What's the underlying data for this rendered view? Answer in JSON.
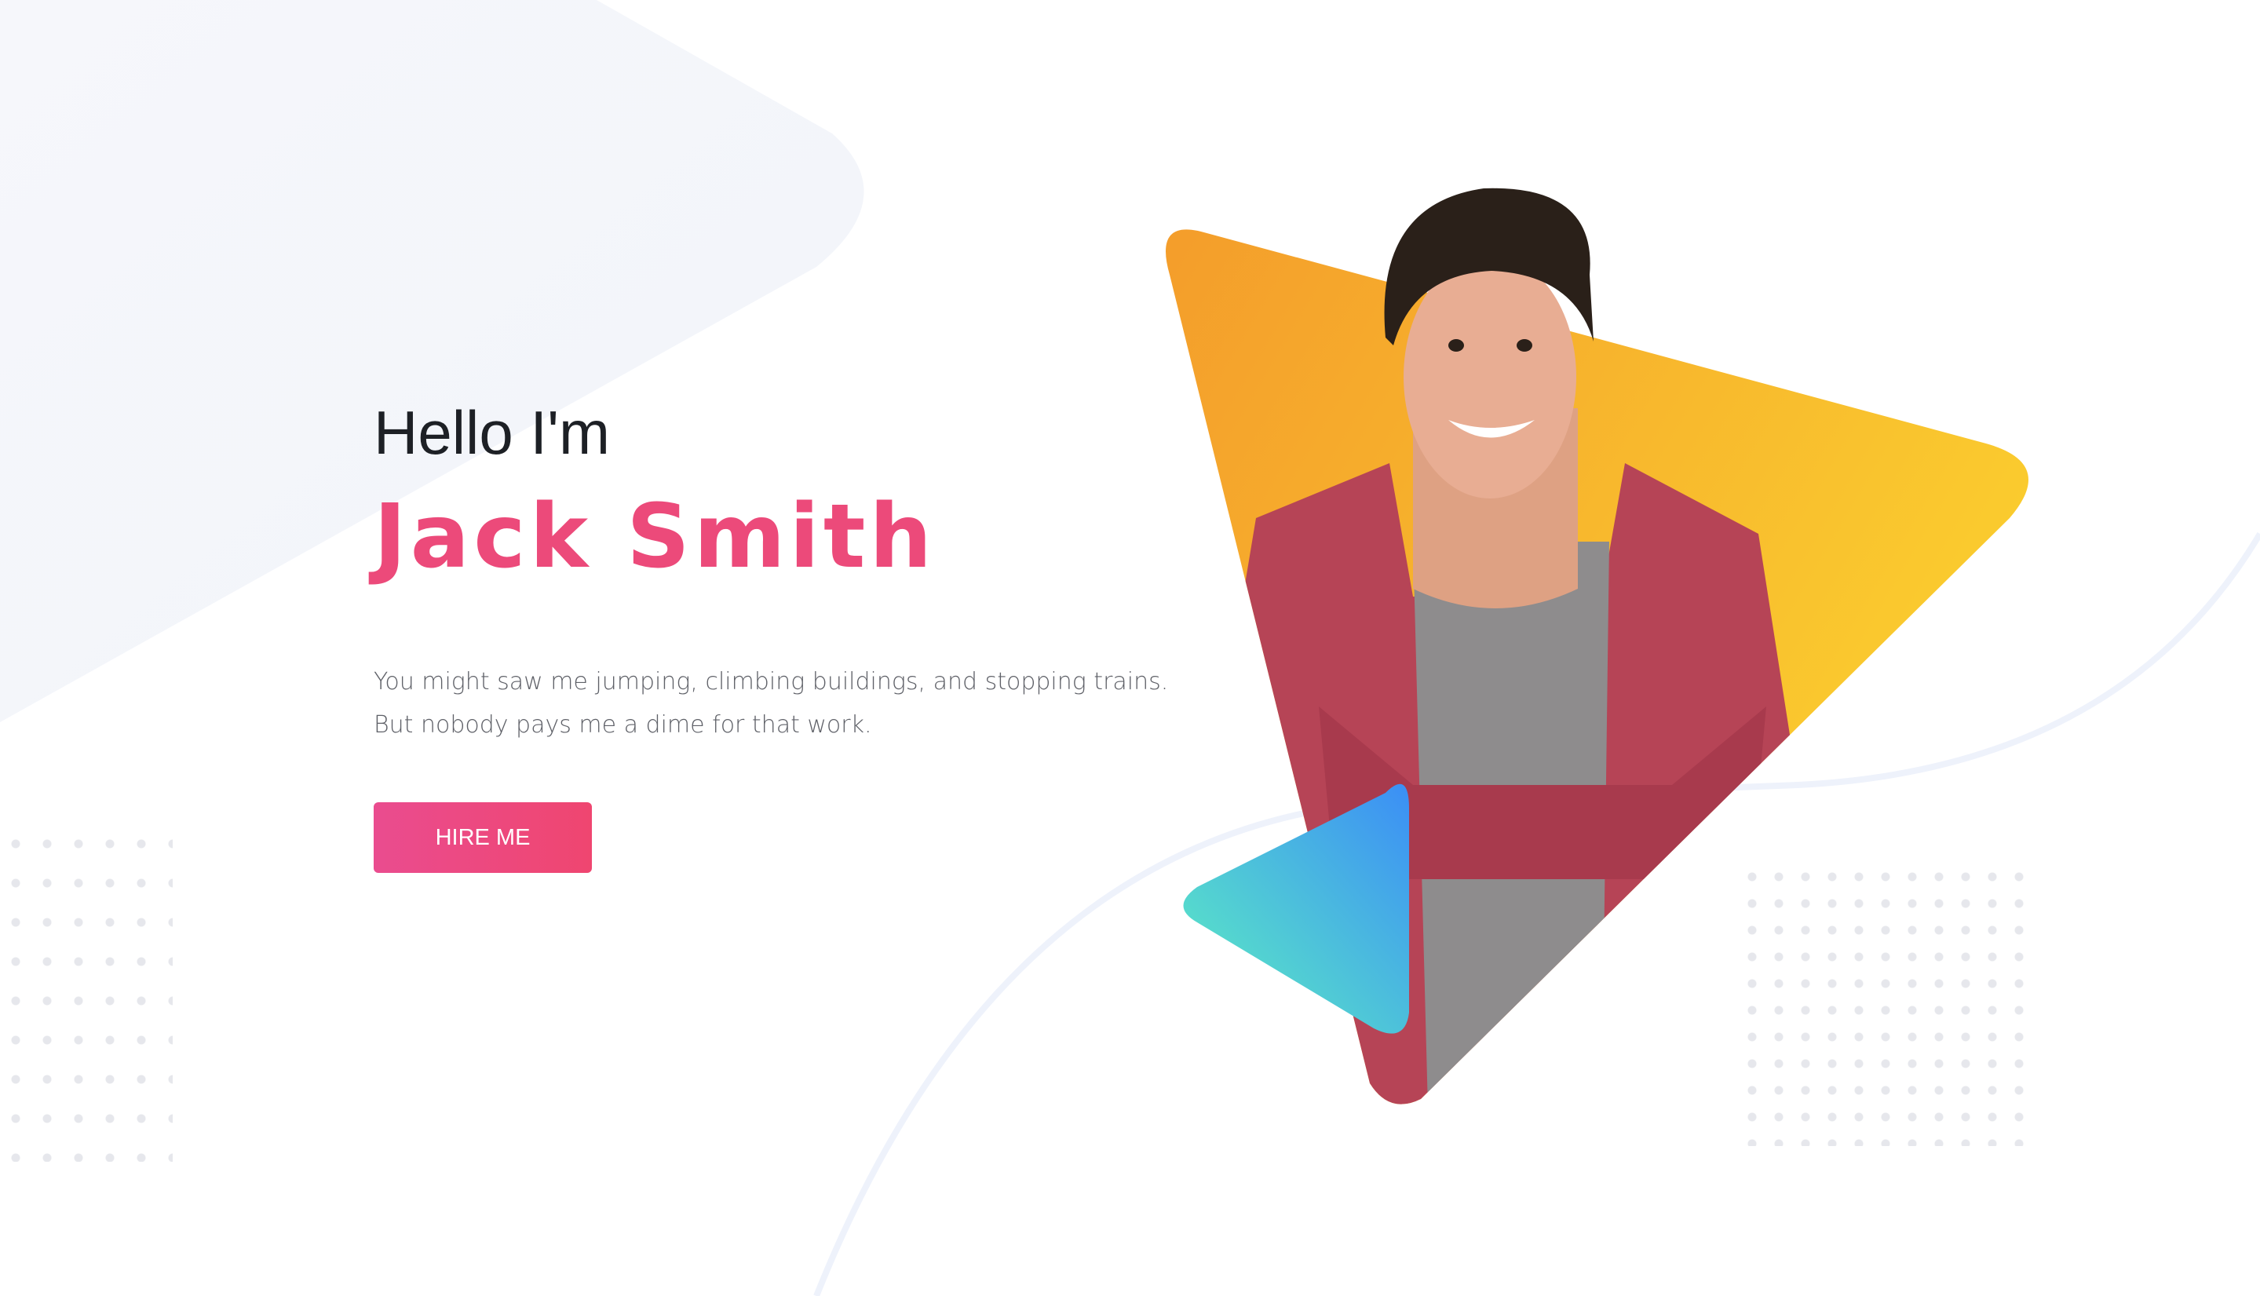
{
  "hero": {
    "greeting": "Hello I'm",
    "name": "Jack Smith",
    "description_line_1": "You might saw me jumping, climbing buildings, and stopping trains.",
    "description_line_2": "But nobody pays me a dime for that work.",
    "cta_label": "HIRE ME"
  },
  "colors": {
    "accent": "#ec4a7a",
    "heading": "#1d2025",
    "body_text": "#5f6168",
    "triangle_orange_start": "#f49d2b",
    "triangle_orange_end": "#fbd22f",
    "triangle_teal_start": "#5ef2c0",
    "triangle_blue_end": "#3b8ef6"
  },
  "icons": {
    "hero_image": "person-portrait",
    "dots_left": "dot-grid-pattern",
    "dots_right": "dot-grid-pattern"
  }
}
